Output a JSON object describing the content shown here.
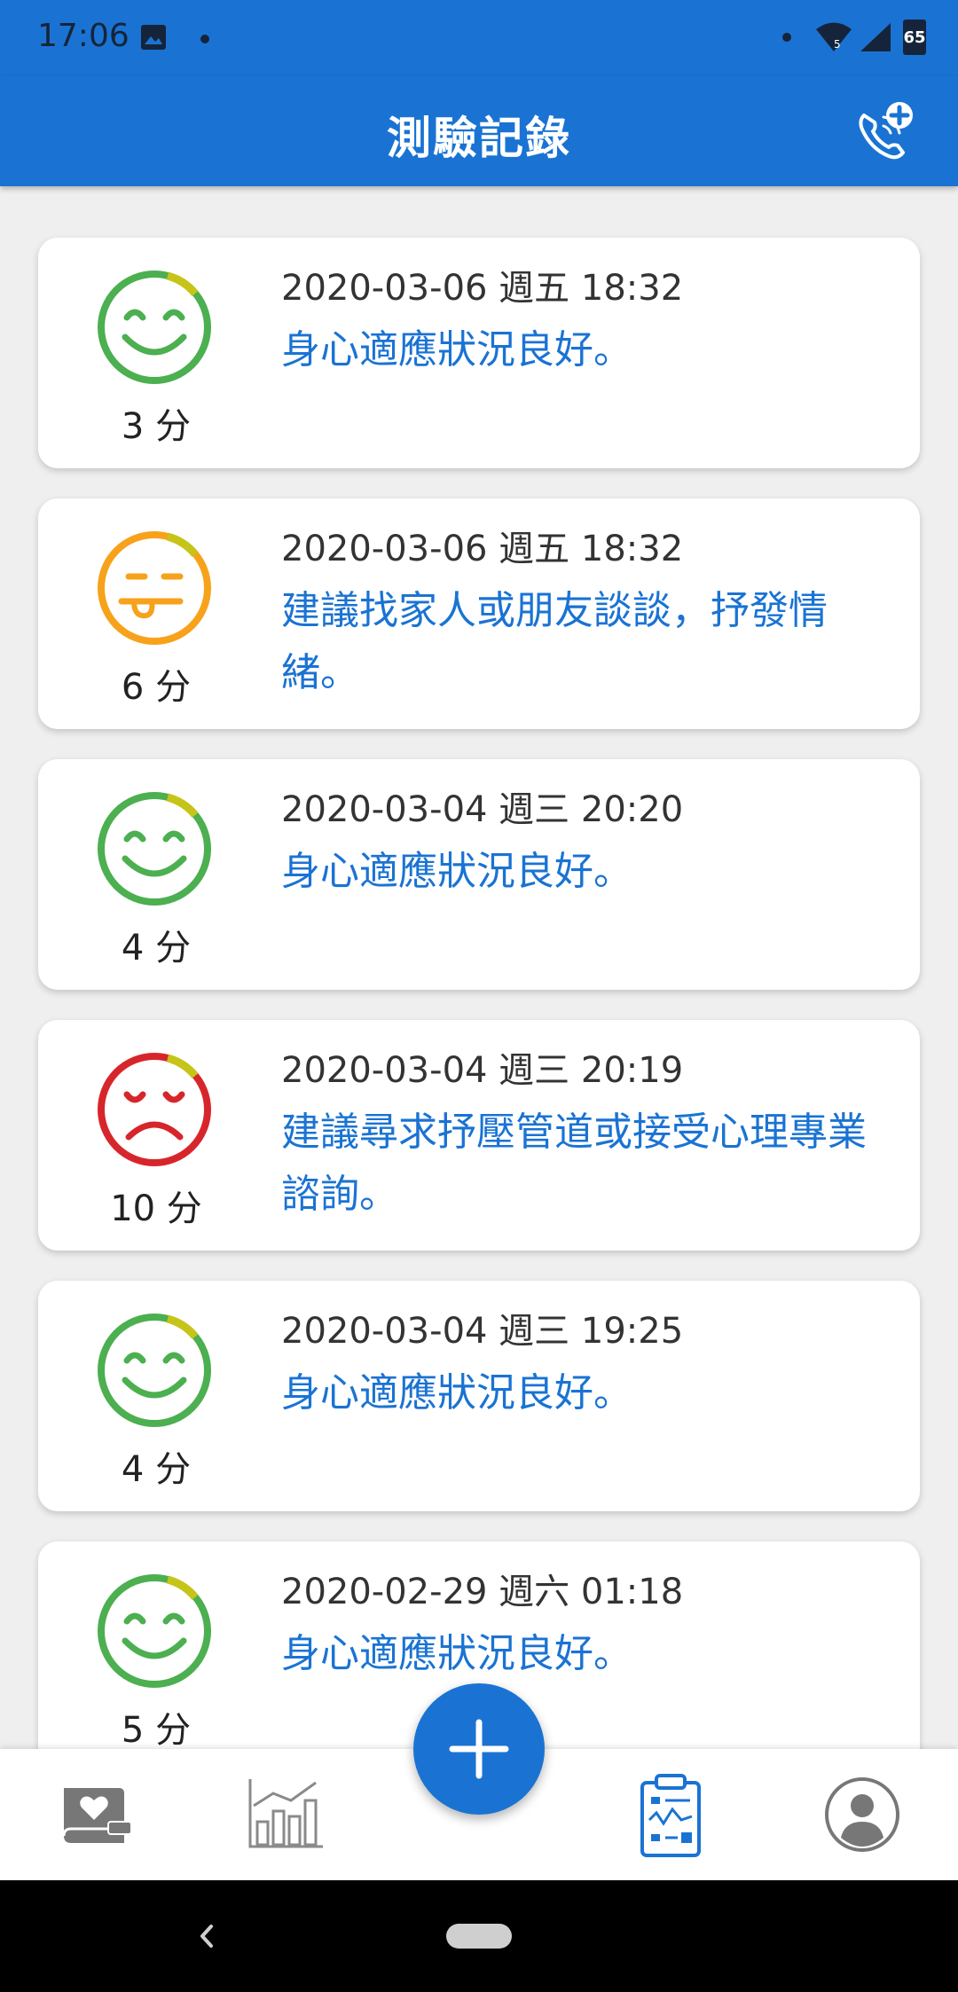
{
  "status_bar": {
    "time": "17:06",
    "battery": "65",
    "signal_badge": "5"
  },
  "header": {
    "title": "測驗記錄"
  },
  "records": [
    {
      "mood": "happy",
      "color": "#4caf50",
      "score": "3 分",
      "date": "2020-03-06 週五 18:32",
      "message": "身心適應狀況良好。"
    },
    {
      "mood": "neutral",
      "color": "#f7a21b",
      "score": "6 分",
      "date": "2020-03-06 週五 18:32",
      "message": "建議找家人或朋友談談，抒發情緒。"
    },
    {
      "mood": "happy",
      "color": "#4caf50",
      "score": "4 分",
      "date": "2020-03-04 週三 20:20",
      "message": "身心適應狀況良好。"
    },
    {
      "mood": "sad",
      "color": "#d7262b",
      "score": "10 分",
      "date": "2020-03-04 週三 20:19",
      "message": "建議尋求抒壓管道或接受心理專業諮詢。"
    },
    {
      "mood": "happy",
      "color": "#4caf50",
      "score": "4 分",
      "date": "2020-03-04 週三 19:25",
      "message": "身心適應狀況良好。"
    },
    {
      "mood": "happy",
      "color": "#4caf50",
      "score": "5 分",
      "date": "2020-02-29 週六 01:18",
      "message": "身心適應狀況良好。"
    }
  ],
  "colors": {
    "primary": "#1a73d3",
    "face_accent": "#c7c419",
    "nav_inactive": "#777777"
  },
  "bottom_nav": [
    {
      "icon": "heart-book-icon",
      "active": false
    },
    {
      "icon": "bar-chart-icon",
      "active": false
    },
    {
      "icon": "add-icon",
      "active": false
    },
    {
      "icon": "clipboard-icon",
      "active": true
    },
    {
      "icon": "profile-icon",
      "active": false
    }
  ]
}
